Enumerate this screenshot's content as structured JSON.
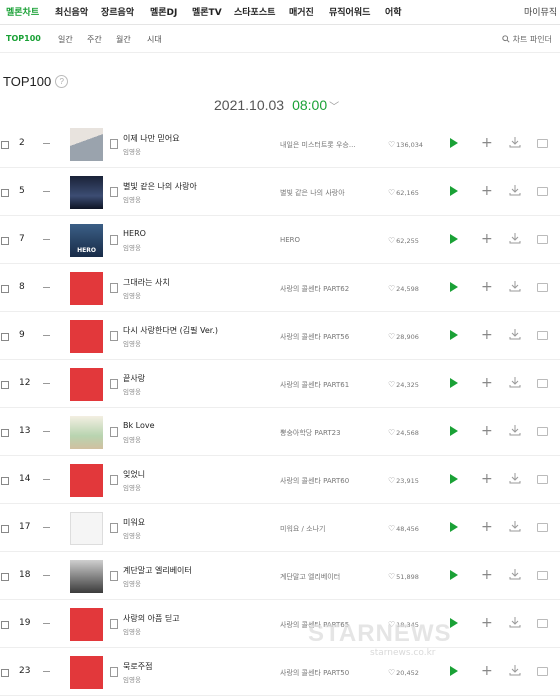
{
  "gnb": [
    "멜론차트",
    "최신음악",
    "장르음악",
    "멜론DJ",
    "멜론TV",
    "스타포스트",
    "매거진",
    "뮤직어워드",
    "어학"
  ],
  "gnb_right": "마이뮤직",
  "sub_tabs": [
    "TOP100",
    "일간",
    "주간",
    "월간",
    "시대"
  ],
  "chart_finder": "차트 파인더",
  "page_title": "TOP100",
  "help": "?",
  "date": "2021.10.03",
  "time": "08:00",
  "rows": [
    {
      "rank": "2",
      "title": "이제 나만 믿어요",
      "artist": "임영웅",
      "album": "내일은 미스터트롯 우승...",
      "likes": "136,034"
    },
    {
      "rank": "5",
      "title": "별빛 같은 나의 사랑아",
      "artist": "임영웅",
      "album": "별빛 같은 나의 사랑아",
      "likes": "62,165"
    },
    {
      "rank": "7",
      "title": "HERO",
      "artist": "임영웅",
      "album": "HERO",
      "likes": "62,255"
    },
    {
      "rank": "8",
      "title": "그대라는 사치",
      "artist": "임영웅",
      "album": "사랑의 콜센타 PART62",
      "likes": "24,598"
    },
    {
      "rank": "9",
      "title": "다시 사랑한다면 (김필 Ver.)",
      "artist": "임영웅",
      "album": "사랑의 콜센타 PART56",
      "likes": "28,906"
    },
    {
      "rank": "12",
      "title": "끝사랑",
      "artist": "임영웅",
      "album": "사랑의 콜센타 PART61",
      "likes": "24,325"
    },
    {
      "rank": "13",
      "title": "Bk Love",
      "artist": "임영웅",
      "album": "뽕숭아학당 PART23",
      "likes": "24,568"
    },
    {
      "rank": "14",
      "title": "잊었니",
      "artist": "임영웅",
      "album": "사랑의 콜센타 PART60",
      "likes": "23,915"
    },
    {
      "rank": "17",
      "title": "미워요",
      "artist": "임영웅",
      "album": "미워요 / 소나기",
      "likes": "48,456"
    },
    {
      "rank": "18",
      "title": "계단말고 엘리베이터",
      "artist": "임영웅",
      "album": "계단말고 엘리베이터",
      "likes": "51,898"
    },
    {
      "rank": "19",
      "title": "사랑의 아픔 딛고",
      "artist": "임영웅",
      "album": "사랑의 콜센타 PART65",
      "likes": "18,345"
    },
    {
      "rank": "23",
      "title": "묵로주점",
      "artist": "임영웅",
      "album": "사랑의 콜센타 PART50",
      "likes": "20,452"
    }
  ],
  "cover_labels": {
    "hero": "HERO"
  },
  "watermark": "STARNEWS",
  "watermark_sub": "starnews.co.kr",
  "accent_color": "#1aa136"
}
